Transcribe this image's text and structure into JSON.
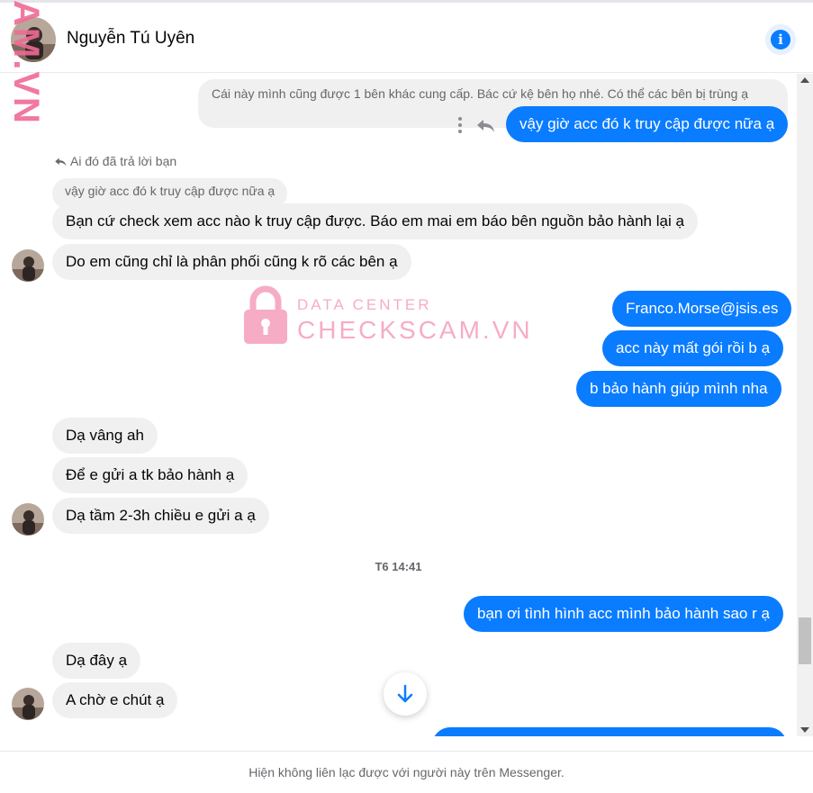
{
  "header": {
    "contact_name": "Nguyễn Tú Uyên",
    "info_icon": "info-icon"
  },
  "watermarks": {
    "side_text": "AM.VN",
    "center_line1": "DATA CENTER",
    "center_line2": "CHECKSCAM.VN"
  },
  "messages": {
    "quoted_top": "Cái này mình cũng được 1 bên khác cung cấp. Bác cứ kệ bên họ nhé. Có thể các bên bị trùng ạ",
    "out_1": "vậy giờ acc đó k truy cập được nữa ạ",
    "reply_note": "Ai đó đã trả lời bạn",
    "quoted_reply": "vậy giờ acc đó k truy cập được nữa ạ",
    "in_1": "Bạn cứ check xem acc nào k truy cập được. Báo em mai em báo bên nguồn bảo hành lại ạ",
    "in_2": "Do em cũng chỉ là phân phối cũng k rõ các bên ạ",
    "out_2": "Franco.Morse@jsis.es",
    "out_3": "acc này mất gói rồi b ạ",
    "out_4": "b bảo hành giúp mình nha",
    "in_3": "Dạ vâng ah",
    "in_4": "Để e gửi a tk bảo hành ạ",
    "in_5": "Dạ tầm 2-3h chiều e gửi a ạ",
    "timestamp": "T6 14:41",
    "out_5": "bạn ơi tình hình acc mình bảo hành sao r ạ",
    "in_6": "Dạ đây ạ",
    "in_7": "A chờ e chút ạ"
  },
  "footer": {
    "notice": "Hiện không liên lạc được với người này trên Messenger."
  },
  "colors": {
    "outgoing": "#0a7cff",
    "incoming": "#f0f0f0",
    "watermark": "#f06a95"
  }
}
